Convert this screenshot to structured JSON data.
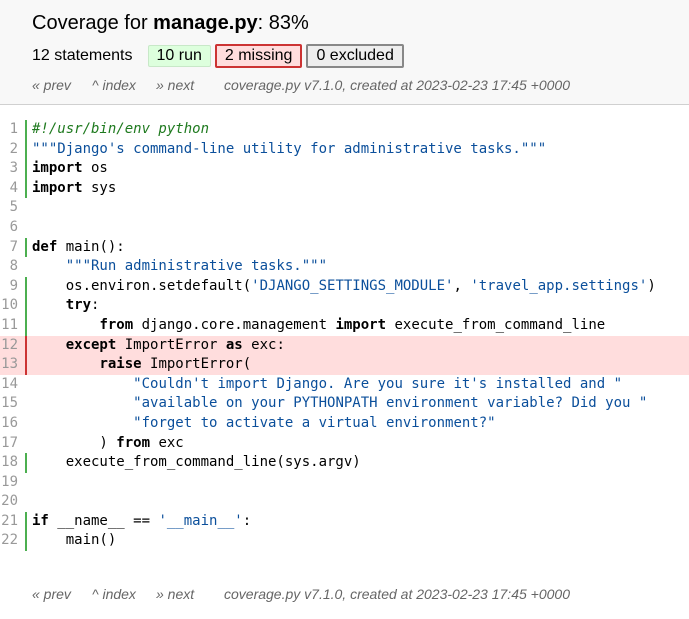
{
  "header": {
    "title_prefix": "Coverage for ",
    "file_name": "manage.py",
    "title_suffix": ": 83%",
    "statements_label": "12 statements",
    "run_label": "10 run",
    "missing_label": "2 missing",
    "excluded_label": "0 excluded"
  },
  "nav": {
    "prev": "« prev",
    "index": "^ index",
    "next": "» next",
    "created": "coverage.py v7.1.0, created at 2023-02-23 17:45 +0000"
  },
  "colors": {
    "run_bar": "#4caf50",
    "missing_bar": "#cc3333",
    "missing_bg": "#ffdddd",
    "run_bg": "#ddffdd"
  },
  "source": {
    "lines": [
      {
        "n": "1",
        "status": "run",
        "tokens": [
          {
            "t": "#!/usr/bin/env python",
            "c": "com"
          }
        ]
      },
      {
        "n": "2",
        "status": "run",
        "tokens": [
          {
            "t": "\"\"\"Django's command-line utility for administrative tasks.\"\"\"",
            "c": "str"
          }
        ]
      },
      {
        "n": "3",
        "status": "run",
        "tokens": [
          {
            "t": "import",
            "c": "kw"
          },
          {
            "t": " os",
            "c": ""
          }
        ]
      },
      {
        "n": "4",
        "status": "run",
        "tokens": [
          {
            "t": "import",
            "c": "kw"
          },
          {
            "t": " sys",
            "c": ""
          }
        ]
      },
      {
        "n": "5",
        "status": "",
        "tokens": []
      },
      {
        "n": "6",
        "status": "",
        "tokens": []
      },
      {
        "n": "7",
        "status": "run",
        "tokens": [
          {
            "t": "def",
            "c": "kw"
          },
          {
            "t": " main():",
            "c": ""
          }
        ]
      },
      {
        "n": "8",
        "status": "",
        "tokens": [
          {
            "t": "    ",
            "c": ""
          },
          {
            "t": "\"\"\"Run administrative tasks.\"\"\"",
            "c": "str"
          }
        ]
      },
      {
        "n": "9",
        "status": "run",
        "tokens": [
          {
            "t": "    os.environ.setdefault(",
            "c": ""
          },
          {
            "t": "'DJANGO_SETTINGS_MODULE'",
            "c": "str"
          },
          {
            "t": ", ",
            "c": ""
          },
          {
            "t": "'travel_app.settings'",
            "c": "str"
          },
          {
            "t": ")",
            "c": ""
          }
        ]
      },
      {
        "n": "10",
        "status": "run",
        "tokens": [
          {
            "t": "    ",
            "c": ""
          },
          {
            "t": "try",
            "c": "kw"
          },
          {
            "t": ":",
            "c": ""
          }
        ]
      },
      {
        "n": "11",
        "status": "run",
        "tokens": [
          {
            "t": "        ",
            "c": ""
          },
          {
            "t": "from",
            "c": "kw"
          },
          {
            "t": " django.core.management ",
            "c": ""
          },
          {
            "t": "import",
            "c": "kw"
          },
          {
            "t": " execute_from_command_line",
            "c": ""
          }
        ]
      },
      {
        "n": "12",
        "status": "mis",
        "tokens": [
          {
            "t": "    ",
            "c": ""
          },
          {
            "t": "except",
            "c": "kw"
          },
          {
            "t": " ImportError ",
            "c": ""
          },
          {
            "t": "as",
            "c": "kw"
          },
          {
            "t": " exc:",
            "c": ""
          }
        ]
      },
      {
        "n": "13",
        "status": "mis",
        "tokens": [
          {
            "t": "        ",
            "c": ""
          },
          {
            "t": "raise",
            "c": "kw"
          },
          {
            "t": " ImportError(",
            "c": ""
          }
        ]
      },
      {
        "n": "14",
        "status": "",
        "tokens": [
          {
            "t": "            ",
            "c": ""
          },
          {
            "t": "\"Couldn't import Django. Are you sure it's installed and \"",
            "c": "str"
          }
        ]
      },
      {
        "n": "15",
        "status": "",
        "tokens": [
          {
            "t": "            ",
            "c": ""
          },
          {
            "t": "\"available on your PYTHONPATH environment variable? Did you \"",
            "c": "str"
          }
        ]
      },
      {
        "n": "16",
        "status": "",
        "tokens": [
          {
            "t": "            ",
            "c": ""
          },
          {
            "t": "\"forget to activate a virtual environment?\"",
            "c": "str"
          }
        ]
      },
      {
        "n": "17",
        "status": "",
        "tokens": [
          {
            "t": "        ) ",
            "c": ""
          },
          {
            "t": "from",
            "c": "kw"
          },
          {
            "t": " exc",
            "c": ""
          }
        ]
      },
      {
        "n": "18",
        "status": "run",
        "tokens": [
          {
            "t": "    execute_from_command_line(sys.argv)",
            "c": ""
          }
        ]
      },
      {
        "n": "19",
        "status": "",
        "tokens": []
      },
      {
        "n": "20",
        "status": "",
        "tokens": []
      },
      {
        "n": "21",
        "status": "run",
        "tokens": [
          {
            "t": "if",
            "c": "kw"
          },
          {
            "t": " __name__ == ",
            "c": ""
          },
          {
            "t": "'__main__'",
            "c": "str"
          },
          {
            "t": ":",
            "c": ""
          }
        ]
      },
      {
        "n": "22",
        "status": "run",
        "tokens": [
          {
            "t": "    main()",
            "c": ""
          }
        ]
      }
    ]
  }
}
